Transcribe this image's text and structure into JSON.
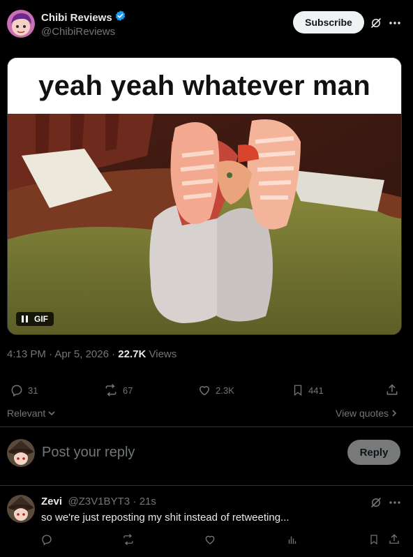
{
  "post": {
    "author": {
      "name": "Chibi Reviews",
      "handle": "@ChibiReviews",
      "verified": true
    },
    "subscribe_label": "Subscribe",
    "media": {
      "caption": "yeah yeah whatever man",
      "badge_label": "GIF"
    },
    "meta": {
      "time": "4:13 PM",
      "date": "Apr 5, 2026",
      "views_count": "22.7K",
      "views_label": "Views"
    },
    "stats": {
      "replies": "31",
      "reposts": "67",
      "likes": "2.3K",
      "bookmarks": "441"
    }
  },
  "replies_sort": {
    "label": "Relevant",
    "view_quotes": "View quotes"
  },
  "composer": {
    "placeholder": "Post your reply",
    "button": "Reply"
  },
  "comment": {
    "name": "Zevi",
    "handle": "@Z3V1BYT3",
    "time": "21s",
    "text": "so we're just reposting my shit instead of retweeting..."
  },
  "colors": {
    "background": "#000000",
    "text": "#e7e9ea",
    "muted": "#71767b",
    "verified": "#1d9bf0",
    "divider": "#2f3336"
  }
}
